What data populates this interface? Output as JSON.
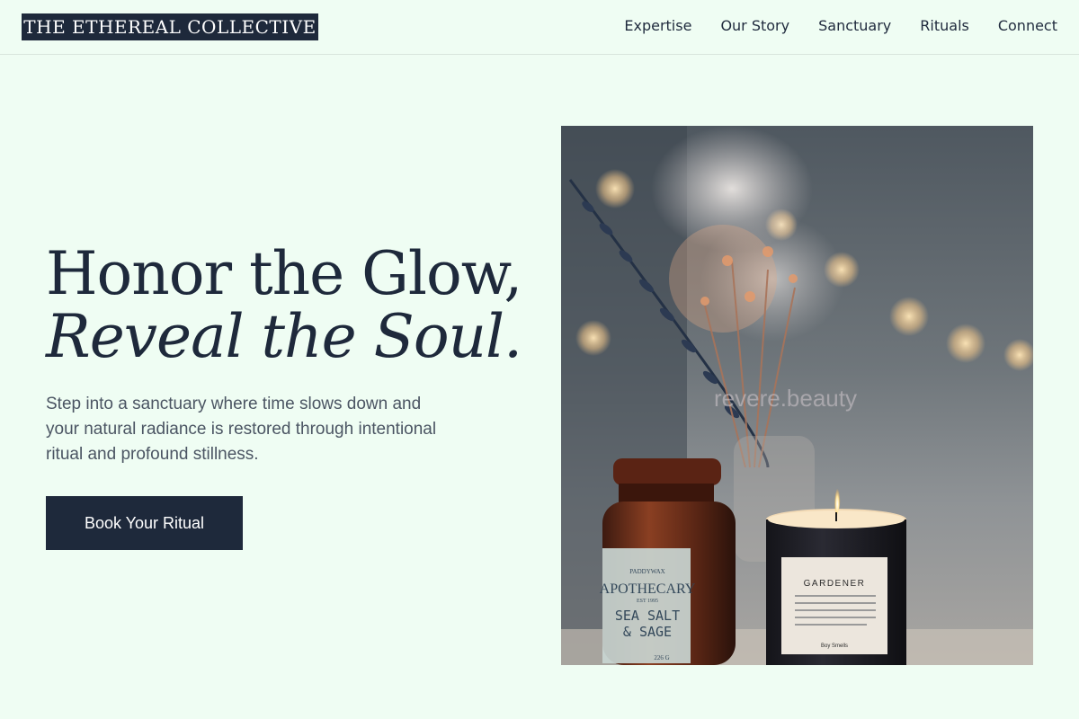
{
  "brand": {
    "logo_text": "THE ETHEREAL COLLECTIVE"
  },
  "nav": {
    "items": [
      {
        "label": "Expertise"
      },
      {
        "label": "Our Story"
      },
      {
        "label": "Sanctuary"
      },
      {
        "label": "Rituals"
      },
      {
        "label": "Connect"
      }
    ]
  },
  "hero": {
    "title_line1": "Honor the Glow,",
    "title_line2": "Reveal the Soul.",
    "subtitle": "Step into a sanctuary where time slows down and your natural radiance is restored through intentional ritual and profound stillness.",
    "cta_label": "Book Your Ritual",
    "image": {
      "watermark": "revere.beauty",
      "jar_label": {
        "brand": "PADDYWAX",
        "line1": "APOTHECARY",
        "line2": "EST 1995",
        "scent1": "SEA SALT",
        "scent2": "& SAGE",
        "price": "226 G"
      },
      "candle_label": {
        "title": "GARDENER",
        "maker": "Boy  Smells"
      }
    }
  },
  "colors": {
    "background": "#effdf3",
    "primary": "#1e293b",
    "text_muted": "#4b5563"
  }
}
